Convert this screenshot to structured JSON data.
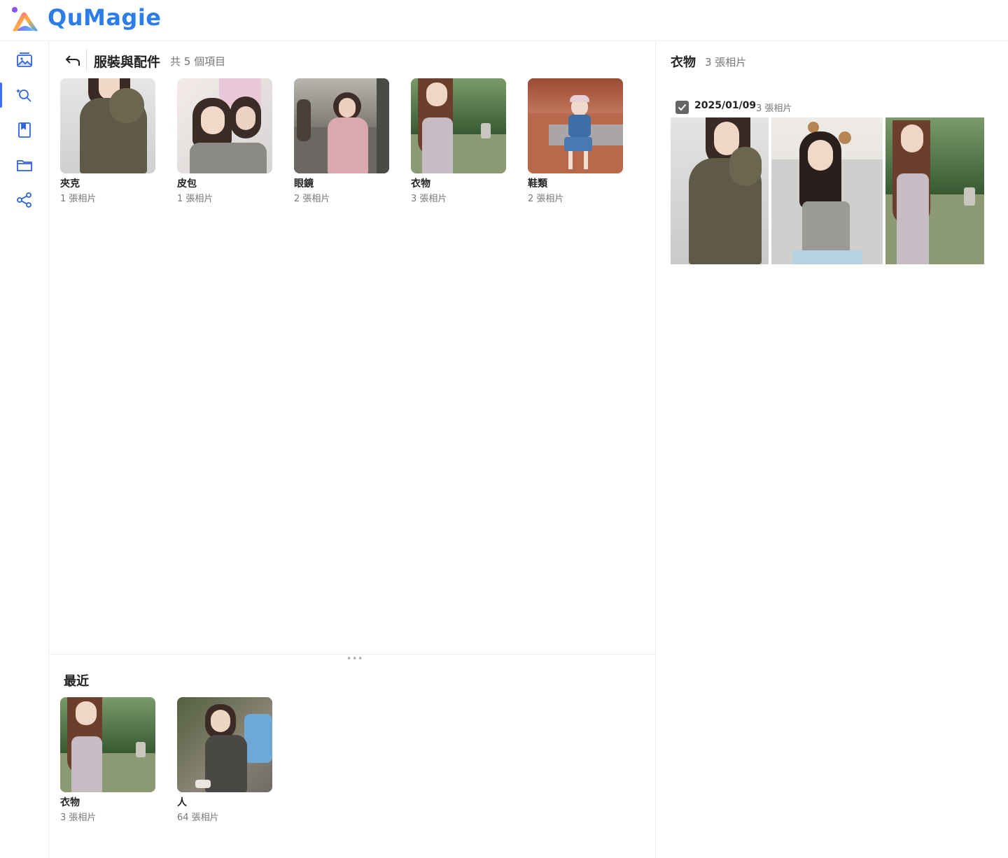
{
  "app": {
    "name": "QuMagie"
  },
  "rail": {
    "items": [
      {
        "name": "photos",
        "icon": "photo-album-icon",
        "active": false
      },
      {
        "name": "ai-recognition",
        "icon": "magic-search-icon",
        "active": true
      },
      {
        "name": "albums",
        "icon": "bookmark-book-icon",
        "active": false
      },
      {
        "name": "folders",
        "icon": "folder-icon",
        "active": false
      },
      {
        "name": "share",
        "icon": "share-icon",
        "active": false
      }
    ]
  },
  "main": {
    "title": "服裝與配件",
    "count": "共 5 個項目",
    "categories": [
      {
        "label": "夾克",
        "sub": "1 張相片"
      },
      {
        "label": "皮包",
        "sub": "1 張相片"
      },
      {
        "label": "眼鏡",
        "sub": "2 張相片"
      },
      {
        "label": "衣物",
        "sub": "3 張相片"
      },
      {
        "label": "鞋類",
        "sub": "2 張相片"
      }
    ]
  },
  "recent": {
    "title": "最近",
    "items": [
      {
        "label": "衣物",
        "sub": "3 張相片"
      },
      {
        "label": "人",
        "sub": "64 張相片"
      }
    ]
  },
  "detail": {
    "title": "衣物",
    "count": "3 張相片",
    "group": {
      "date": "2025/01/09",
      "count": "3 張相片",
      "checked": true
    }
  }
}
